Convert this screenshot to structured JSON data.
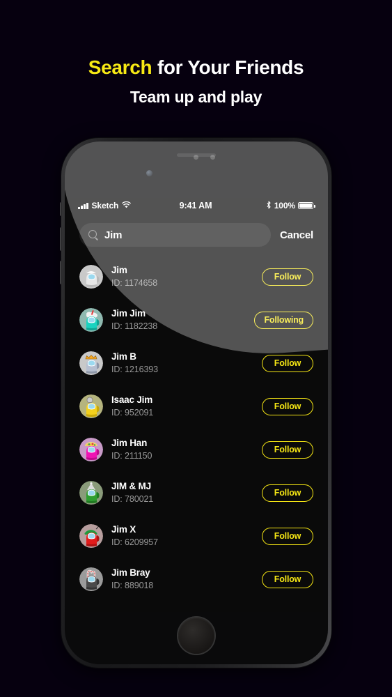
{
  "promo": {
    "title_highlight": "Search",
    "title_rest": " for Your Friends",
    "subtitle": "Team up and play",
    "highlight_color": "#f7e914"
  },
  "statusbar": {
    "carrier": "Sketch",
    "signal_icon": "signal-bars-icon",
    "wifi_icon": "wifi-icon",
    "time": "9:41 AM",
    "bluetooth_icon": "bluetooth-icon",
    "battery_percent": "100%",
    "battery_icon": "battery-full-icon"
  },
  "search": {
    "icon": "search-icon",
    "value": "Jim",
    "placeholder": "Search",
    "cancel_label": "Cancel"
  },
  "users": [
    {
      "name": "Jim",
      "id_label": "ID: 1174658",
      "action": "Follow",
      "following": false,
      "avatar": {
        "bg": "#c9c9c9",
        "body": "#e8e8e8",
        "shade": "#b9b9b9",
        "hat": "none",
        "hat_color": "#ffffff"
      }
    },
    {
      "name": "Jim Jim",
      "id_label": "ID: 1182238",
      "action": "Following",
      "following": true,
      "avatar": {
        "bg": "#8fb9b0",
        "body": "#19d3c0",
        "shade": "#11a393",
        "hat": "whipped",
        "hat_color": "#f2f2f2"
      }
    },
    {
      "name": "Jim B",
      "id_label": "ID: 1216393",
      "action": "Follow",
      "following": false,
      "avatar": {
        "bg": "#c9c9c9",
        "body": "#b6bfd0",
        "shade": "#8e97a8",
        "hat": "crown",
        "hat_color": "#f5a623"
      }
    },
    {
      "name": "Isaac Jim",
      "id_label": "ID: 952091",
      "action": "Follow",
      "following": false,
      "avatar": {
        "bg": "#b5b47e",
        "body": "#f3d01c",
        "shade": "#c9a908",
        "hat": "lamp",
        "hat_color": "#cccccc"
      }
    },
    {
      "name": "Jim Han",
      "id_label": "ID: 211150",
      "action": "Follow",
      "following": false,
      "avatar": {
        "bg": "#c89ac7",
        "body": "#ef13b4",
        "shade": "#bd0c8d",
        "hat": "taco",
        "hat_color": "#f5c542"
      }
    },
    {
      "name": "JIM & MJ",
      "id_label": "ID: 780021",
      "action": "Follow",
      "following": false,
      "avatar": {
        "bg": "#8a9b7a",
        "body": "#2f9e30",
        "shade": "#207a22",
        "hat": "party",
        "hat_color": "#dcdcdc"
      }
    },
    {
      "name": "Jim X",
      "id_label": "ID: 6209957",
      "action": "Follow",
      "following": false,
      "avatar": {
        "bg": "#b79e9e",
        "body": "#e21b1b",
        "shade": "#ad1212",
        "hat": "beanie",
        "hat_color": "#1f9b3c"
      }
    },
    {
      "name": "Jim Bray",
      "id_label": "ID: 889018",
      "action": "Follow",
      "following": false,
      "avatar": {
        "bg": "#9b9b9b",
        "body": "#4a4a4a",
        "shade": "#343434",
        "hat": "candycane",
        "hat_color": "#e8e8e8"
      }
    }
  ],
  "theme": {
    "accent": "#f5e614",
    "page_background": "#06000f",
    "screen_background": "#0a0a0a",
    "search_field_background": "#1d1d1d",
    "id_text_color": "#9a9a9a"
  },
  "phone": {
    "home_button": "home-button",
    "camera": "front-camera-icon",
    "speaker": "earpiece-speaker"
  }
}
